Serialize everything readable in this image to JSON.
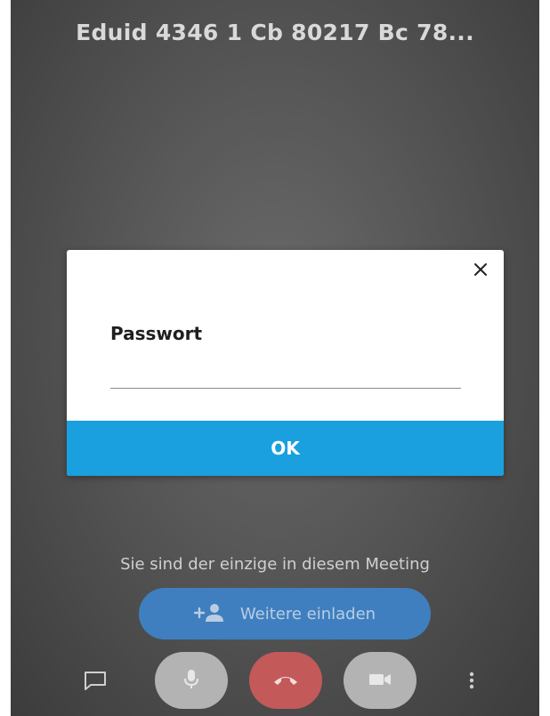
{
  "meeting": {
    "title": "Eduid 4346 1 Cb 80217 Bc 78..."
  },
  "dialog": {
    "close_icon": "close-icon",
    "label": "Passwort",
    "password_value": "",
    "ok_label": "OK"
  },
  "status": {
    "message": "Sie sind der einzige in diesem Meeting"
  },
  "invite": {
    "icon": "add-person-icon",
    "label": "Weitere einladen"
  },
  "toolbar": {
    "chat_icon": "chat-icon",
    "mic_icon": "microphone-icon",
    "hangup_icon": "hangup-icon",
    "video_icon": "video-camera-icon",
    "more_icon": "more-vertical-icon"
  },
  "colors": {
    "accent": "#1aa0de",
    "invite": "#3f7fbf",
    "hangup": "#c4595a",
    "control": "#b3b3b3"
  }
}
